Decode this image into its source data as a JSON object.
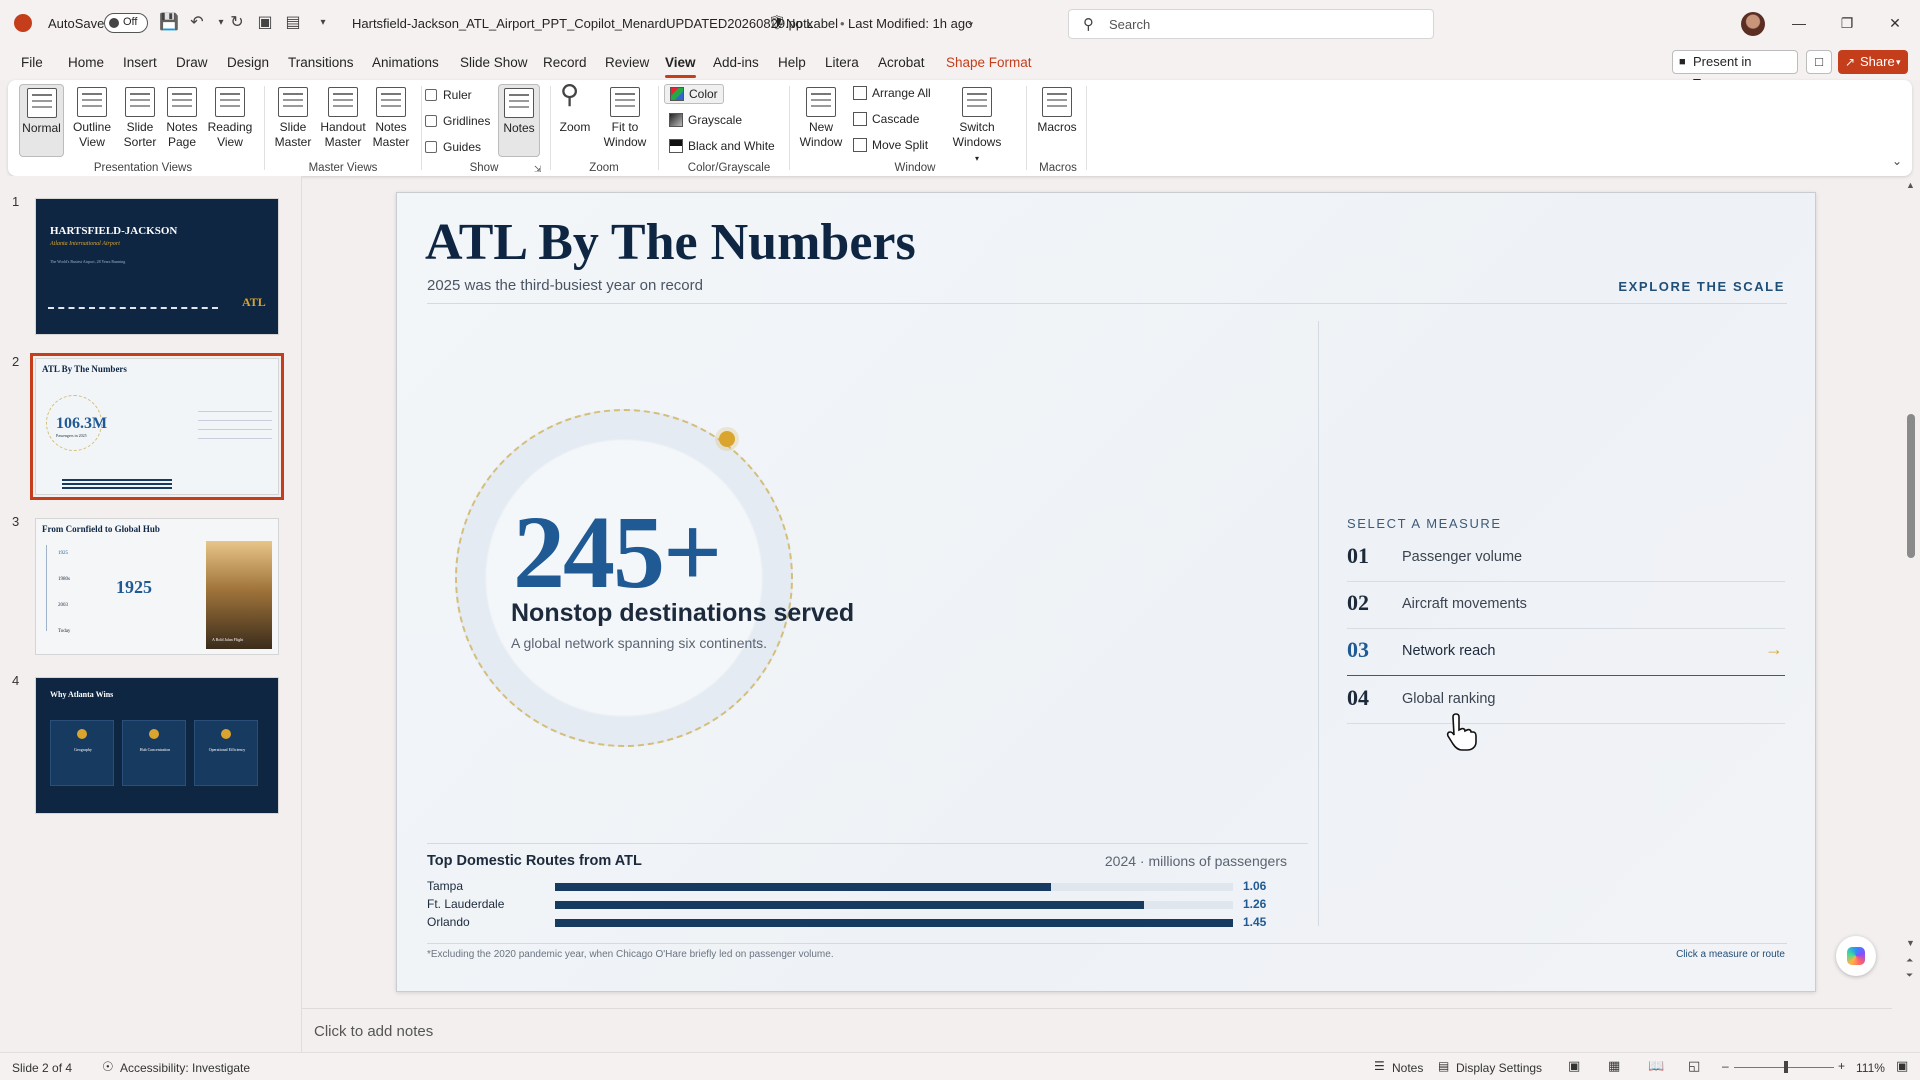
{
  "titlebar": {
    "autosave_label": "AutoSave",
    "autosave_state": "Off",
    "filename": "Hartsfield-Jackson_ATL_Airport_PPT_Copilot_MenardUPDATED20260829.pptx",
    "label_status": "No Label",
    "last_modified": "Last Modified: 1h ago",
    "search_placeholder": "Search"
  },
  "menu": {
    "items": [
      "File",
      "Home",
      "Insert",
      "Draw",
      "Design",
      "Transitions",
      "Animations",
      "Slide Show",
      "Record",
      "Review",
      "View",
      "Add-ins",
      "Help",
      "Litera",
      "Acrobat",
      "Shape Format"
    ],
    "active": "View",
    "present_teams": "Present in Teams",
    "share": "Share"
  },
  "ribbon": {
    "presentation_views": {
      "name": "Presentation Views",
      "buttons": [
        "Normal",
        "Outline View",
        "Slide Sorter",
        "Notes Page",
        "Reading View"
      ]
    },
    "master_views": {
      "name": "Master Views",
      "buttons": [
        "Slide Master",
        "Handout Master",
        "Notes Master"
      ]
    },
    "show": {
      "name": "Show",
      "checkboxes": [
        "Ruler",
        "Gridlines",
        "Guides"
      ],
      "notes": "Notes"
    },
    "zoom": {
      "name": "Zoom",
      "buttons": [
        "Zoom",
        "Fit to Window"
      ]
    },
    "color": {
      "name": "Color/Grayscale",
      "options": [
        "Color",
        "Grayscale",
        "Black and White"
      ]
    },
    "window": {
      "name": "Window",
      "new_window": "New Window",
      "options": [
        "Arrange All",
        "Cascade",
        "Move Split"
      ],
      "switch": "Switch Windows"
    },
    "macros": {
      "name": "Macros",
      "button": "Macros"
    }
  },
  "thumbnails": [
    {
      "num": "1",
      "title": "HARTSFIELD-JACKSON",
      "subtitle": "Atlanta International Airport",
      "tag": "The World's Busiest Airport, 28 Years Running",
      "badge": "ATL"
    },
    {
      "num": "2",
      "title": "ATL By The Numbers",
      "stat": "106.3M",
      "stat_label": "Passengers in 2025"
    },
    {
      "num": "3",
      "title": "From Cornfield to Global Hub",
      "year": "1925",
      "caption": "A Bold Jalan Flight",
      "timeline": [
        "1925",
        "1980s",
        "2003",
        "Today"
      ]
    },
    {
      "num": "4",
      "title": "Why Atlanta Wins",
      "cards": [
        "Geography",
        "Hub Concentration",
        "Operational Efficiency"
      ]
    }
  ],
  "slide": {
    "title": "ATL By The Numbers",
    "subtitle": "2025 was the third-busiest year on record",
    "explore": "EXPLORE THE SCALE",
    "big_number": "245+",
    "big_heading": "Nonstop destinations served",
    "big_desc": "A global network spanning six continents.",
    "select_label": "SELECT A MEASURE",
    "measures": [
      {
        "num": "01",
        "label": "Passenger volume"
      },
      {
        "num": "02",
        "label": "Aircraft movements"
      },
      {
        "num": "03",
        "label": "Network reach",
        "arrow": "→"
      },
      {
        "num": "04",
        "label": "Global ranking"
      }
    ],
    "active_measure": "03",
    "routes_title": "Top Domestic Routes from ATL",
    "routes_note": "2024 · millions of passengers",
    "routes": [
      {
        "name": "Tampa",
        "value": 1.06,
        "display": "1.06"
      },
      {
        "name": "Ft. Lauderdale",
        "value": 1.26,
        "display": "1.26"
      },
      {
        "name": "Orlando",
        "value": 1.45,
        "display": "1.45"
      }
    ],
    "footnote": "*Excluding the 2020 pandemic year, when Chicago O'Hare briefly led on passenger volume.",
    "click_hint": "Click a measure or route"
  },
  "notes_placeholder": "Click to add notes",
  "status": {
    "slide_of": "Slide 2 of 4",
    "accessibility": "Accessibility: Investigate",
    "notes": "Notes",
    "display_settings": "Display Settings",
    "zoom": "111%"
  },
  "colors": {
    "accent": "#c43e1c",
    "navy": "#0f2643",
    "blue": "#1f5a94",
    "gold": "#d9a52e"
  }
}
